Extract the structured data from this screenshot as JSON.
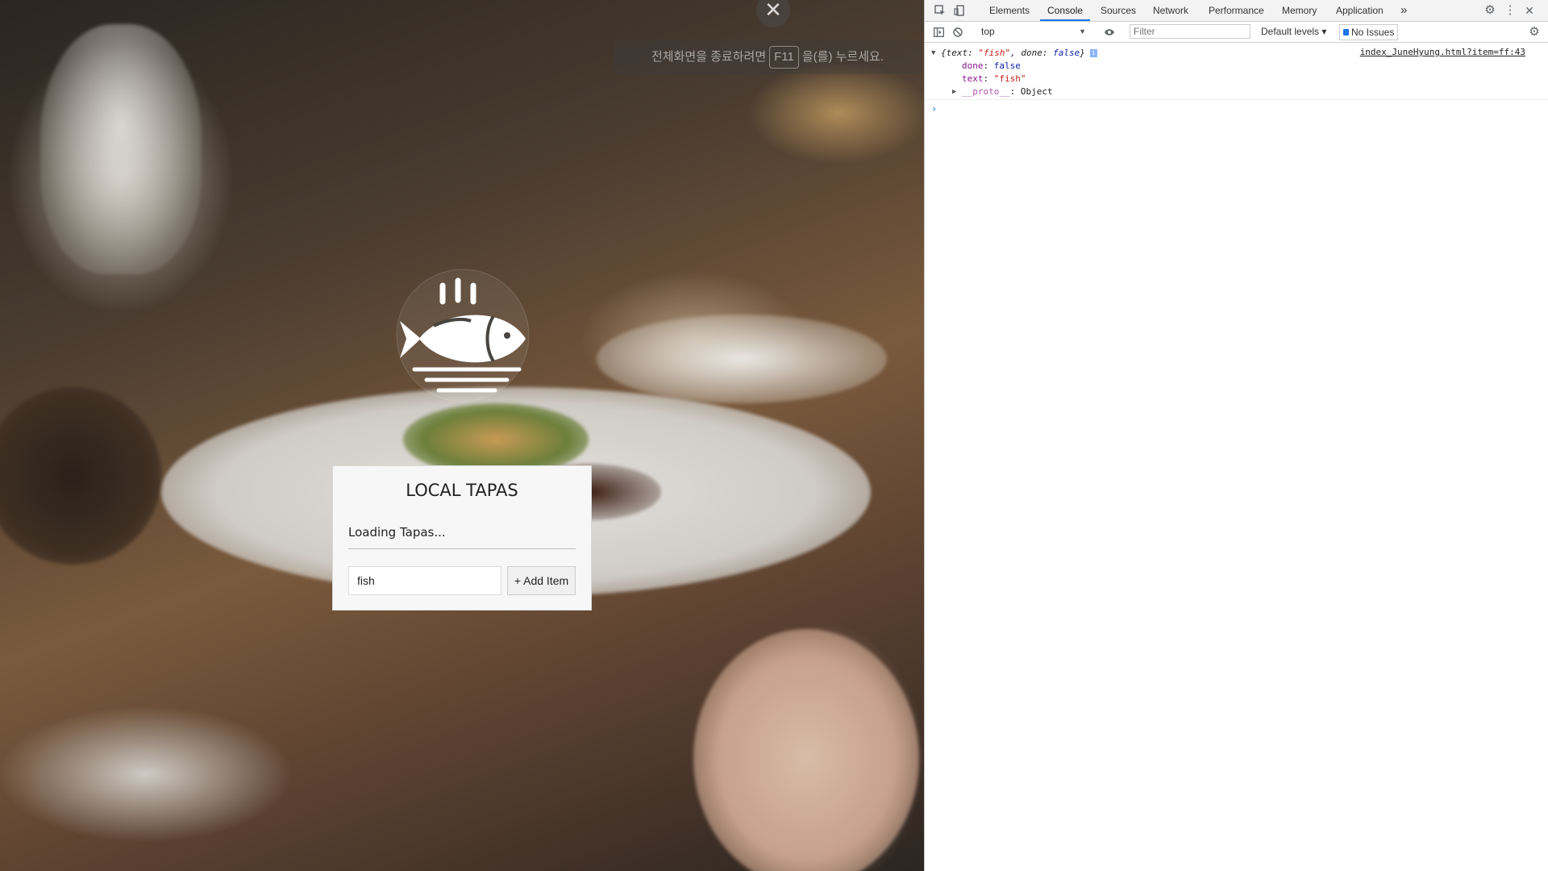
{
  "page": {
    "fullscreen_hint": {
      "before": "전체화면을 종료하려면",
      "key": "F11",
      "after": "을(를) 누르세요.",
      "close_glyph": "✕"
    },
    "logo_icon": "steaming-fish-icon",
    "todo": {
      "title": "LOCAL TAPAS",
      "status": "Loading Tapas...",
      "input_value": "fish",
      "add_button_label": "+ Add Item"
    }
  },
  "devtools": {
    "tabs": [
      "Elements",
      "Console",
      "Sources",
      "Network",
      "Performance",
      "Memory",
      "Application"
    ],
    "active_tab": "Console",
    "more_tabs_glyph": "»",
    "toolbar": {
      "context": "top",
      "filter_placeholder": "Filter",
      "levels_label": "Default levels ▾",
      "issues_label": "No Issues"
    },
    "console": {
      "summary_prefix": "{text: ",
      "summary_text_value": "\"fish\"",
      "summary_mid": ", done: ",
      "summary_done_value": "false",
      "summary_suffix": "}",
      "prop_done_key": "done",
      "prop_done_value": "false",
      "prop_text_key": "text",
      "prop_text_value": "\"fish\"",
      "proto_key": "__proto__",
      "proto_value": "Object",
      "source": "index_JuneHyung.html?item=ff:43",
      "info_badge": "i",
      "prompt": "›"
    },
    "colors": {
      "active_tab_underline": "#1a73e8",
      "string": "#c41a16",
      "key": "#881391",
      "boolean": "#0d22aa"
    }
  }
}
